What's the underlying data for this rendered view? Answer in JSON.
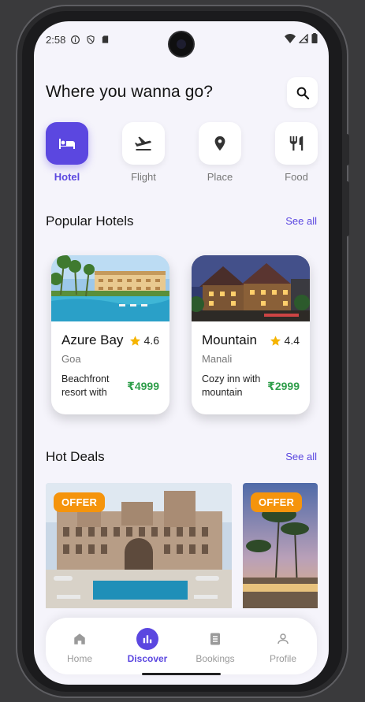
{
  "status_bar": {
    "time": "2:58",
    "icons": [
      "info-icon",
      "shield-icon",
      "sd-card-icon"
    ],
    "right_icons": [
      "wifi-icon",
      "signal-icon",
      "battery-icon"
    ]
  },
  "header": {
    "title": "Where you wanna go?",
    "search_icon": "search-icon"
  },
  "categories": [
    {
      "label": "Hotel",
      "icon": "bed-icon",
      "active": true
    },
    {
      "label": "Flight",
      "icon": "flight-icon",
      "active": false
    },
    {
      "label": "Place",
      "icon": "location-pin-icon",
      "active": false
    },
    {
      "label": "Food",
      "icon": "restaurant-icon",
      "active": false
    }
  ],
  "popular_hotels": {
    "title": "Popular Hotels",
    "see_all": "See all",
    "items": [
      {
        "name": "Azure Bay",
        "rating": "4.6",
        "city": "Goa",
        "description": "Beachfront resort with",
        "price": "₹4999"
      },
      {
        "name": "Mountain",
        "rating": "4.4",
        "city": "Manali",
        "description": "Cozy inn with mountain",
        "price": "₹2999"
      }
    ]
  },
  "hot_deals": {
    "title": "Hot Deals",
    "see_all": "See all",
    "items": [
      {
        "badge": "OFFER"
      },
      {
        "badge": "OFFER"
      }
    ]
  },
  "bottom_nav": [
    {
      "label": "Home",
      "icon": "home-icon",
      "active": false
    },
    {
      "label": "Discover",
      "icon": "bar-chart-icon",
      "active": true
    },
    {
      "label": "Bookings",
      "icon": "document-icon",
      "active": false
    },
    {
      "label": "Profile",
      "icon": "person-icon",
      "active": false
    }
  ],
  "colors": {
    "accent": "#5b47e0",
    "price": "#2e9e4a",
    "offer": "#f5940c",
    "star": "#f5b400",
    "background": "#f5f4fb"
  }
}
